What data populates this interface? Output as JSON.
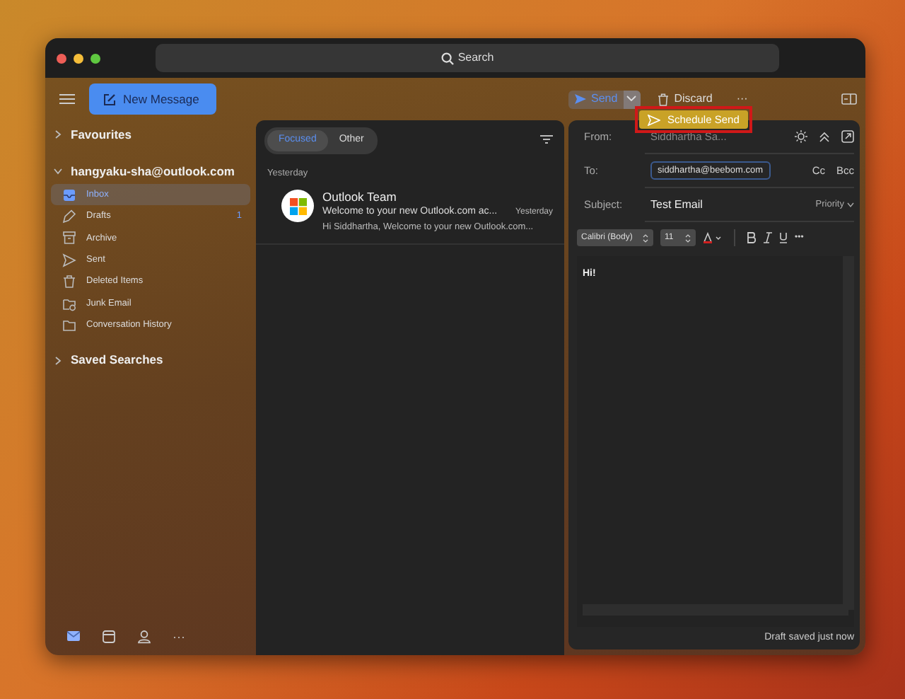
{
  "window": {
    "search": "Search"
  },
  "toolbar": {
    "new_message": "New Message",
    "send": "Send",
    "discard": "Discard",
    "more": "···",
    "schedule_send": "Schedule Send"
  },
  "sidebar": {
    "sections": [
      {
        "label": "Favourites",
        "expanded": false
      },
      {
        "label": "hangyaku-sha@outlook.com",
        "expanded": true,
        "folders": [
          {
            "label": "Inbox",
            "kind": "inbox",
            "selected": true
          },
          {
            "label": "Drafts",
            "kind": "drafts",
            "selected": false,
            "count": "1"
          },
          {
            "label": "Archive",
            "kind": "archive",
            "selected": false
          },
          {
            "label": "Sent",
            "kind": "sent",
            "selected": false
          },
          {
            "label": "Deleted Items",
            "kind": "trash",
            "selected": false
          },
          {
            "label": "Junk Email",
            "kind": "junk",
            "selected": false
          },
          {
            "label": "Conversation History",
            "kind": "folder",
            "selected": false
          }
        ]
      },
      {
        "label": "Saved Searches",
        "expanded": false
      }
    ],
    "nav": [
      {
        "kind": "mail",
        "selected": true
      },
      {
        "kind": "calendar",
        "selected": false
      },
      {
        "kind": "people",
        "selected": false
      },
      {
        "kind": "more",
        "selected": false,
        "text": "···"
      }
    ]
  },
  "message_list": {
    "tabs": [
      {
        "label": "Focused",
        "selected": true
      },
      {
        "label": "Other",
        "selected": false
      }
    ],
    "groups": [
      {
        "label": "Yesterday",
        "messages": [
          {
            "sender": "Outlook Team",
            "subject": "Welcome to your new Outlook.com ac...",
            "time": "Yesterday",
            "preview": "Hi Siddhartha, Welcome to your new Outlook.com..."
          }
        ]
      }
    ]
  },
  "compose": {
    "from_label": "From:",
    "from": "Siddhartha Sa...",
    "to_label": "To:",
    "recipient": "siddhartha@beebom.com",
    "cc": "Cc",
    "bcc": "Bcc",
    "subject_label": "Subject:",
    "subject": "Test Email",
    "priority": "Priority",
    "font": "Calibri (Body)",
    "size": "11",
    "more": "•••",
    "body": "Hi!",
    "status": "Draft saved just now"
  }
}
